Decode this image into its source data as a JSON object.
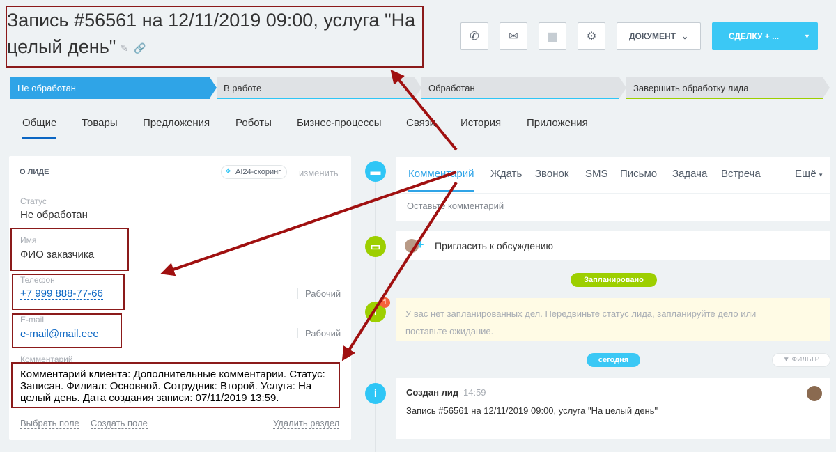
{
  "header": {
    "title": "Запись #56561 на 12/11/2019 09:00, услуга \"На целый день\"",
    "document_label": "ДОКУМЕНТ",
    "deal_label": "СДЕЛКУ + ..."
  },
  "stages": [
    {
      "label": "Не обработан",
      "color": "#2fa4e7"
    },
    {
      "label": "В работе",
      "color": "#2fc6f6"
    },
    {
      "label": "Обработан",
      "color": "#2fc6f6"
    },
    {
      "label": "Завершить обработку лида",
      "color": "#9dcf00"
    }
  ],
  "tabs": [
    "Общие",
    "Товары",
    "Предложения",
    "Роботы",
    "Бизнес-процессы",
    "Связи",
    "История",
    "Приложения"
  ],
  "card": {
    "title": "О ЛИДЕ",
    "ai_badge": "AI24-скоринг",
    "change": "изменить",
    "status_label": "Статус",
    "status_value": "Не обработан",
    "name_label": "Имя",
    "name_value": "ФИО заказчика",
    "phone_label": "Телефон",
    "phone_value": "+7 999 888-77-66",
    "phone_type": "Рабочий",
    "email_label": "E-mail",
    "email_value": "e-mail@mail.eee",
    "email_type": "Рабочий",
    "comment_label": "Комментарий",
    "comment_value": "Комментарий клиента: Дополнительные комментарии. Статус: Записан. Филиал: Основной. Сотрудник: Второй. Услуга: На целый день. Дата создания записи: 07/11/2019 13:59.",
    "select_field": "Выбрать поле",
    "create_field": "Создать поле",
    "delete_section": "Удалить раздел"
  },
  "composer": {
    "tabs": [
      "Комментарий",
      "Ждать",
      "Звонок",
      "SMS",
      "Письмо",
      "Задача",
      "Встреча"
    ],
    "more": "Ещё",
    "placeholder": "Оставьте комментарий"
  },
  "timeline": {
    "invite": "Пригласить к обсуждению",
    "planned_pill": "Запланировано",
    "planned_count": "1",
    "planned_text": "У вас нет запланированных дел. Передвиньте статус лида, запланируйте дело или поставьте ожидание.",
    "today_pill": "сегодня",
    "filter": "ФИЛЬТР",
    "created_title": "Создан лид",
    "created_time": "14:59",
    "created_desc": "Запись #56561 на 12/11/2019 09:00, услуга \"На целый день\""
  },
  "icons": [
    "phone-icon",
    "mail-icon",
    "chat-icon",
    "gear-icon",
    "pencil-icon",
    "link-icon",
    "ai-icon",
    "comment-icon",
    "info-icon",
    "filter-icon"
  ],
  "colors": {
    "accent": "#2fa4e7",
    "green": "#9dcf00",
    "annotation": "#8b1a1a"
  }
}
